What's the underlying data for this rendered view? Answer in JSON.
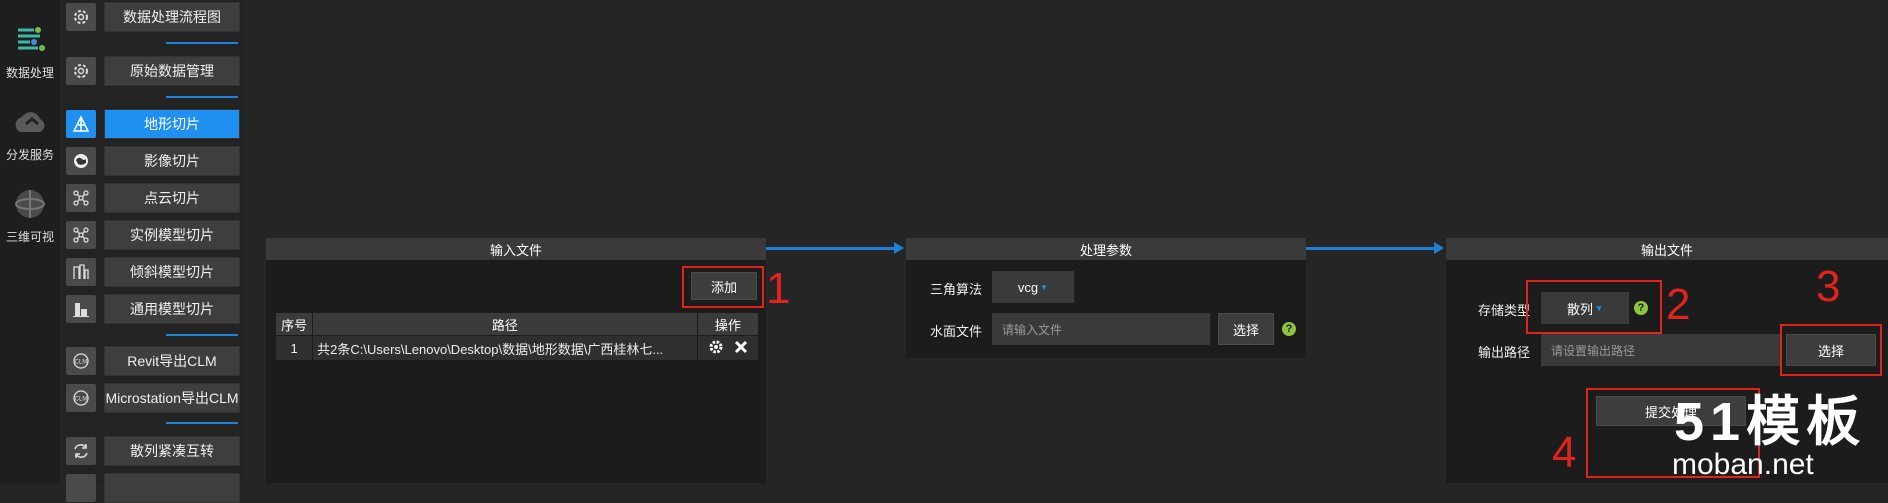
{
  "leftnav": {
    "items": [
      {
        "label": "数据处理",
        "icon": "data-process-icon"
      },
      {
        "label": "分发服务",
        "icon": "cloud-icon"
      },
      {
        "label": "三维可视",
        "icon": "globe-icon"
      }
    ]
  },
  "menu": {
    "items": [
      {
        "label": "数据处理流程图",
        "icon": "gear-icon"
      },
      {
        "label": "原始数据管理",
        "icon": "gear-icon"
      },
      {
        "label": "地形切片",
        "icon": "terrain-icon"
      },
      {
        "label": "影像切片",
        "icon": "image-globe-icon"
      },
      {
        "label": "点云切片",
        "icon": "pointcloud-icon"
      },
      {
        "label": "实例模型切片",
        "icon": "instance-model-icon"
      },
      {
        "label": "倾斜模型切片",
        "icon": "oblique-model-icon"
      },
      {
        "label": "通用模型切片",
        "icon": "general-model-icon"
      },
      {
        "label": "Revit导出CLM",
        "icon": "clm-icon"
      },
      {
        "label": "Microstation导出CLM",
        "icon": "clm-icon"
      },
      {
        "label": "散列紧凑互转",
        "icon": "convert-icon"
      }
    ]
  },
  "input_panel": {
    "title": "输入文件",
    "add_label": "添加",
    "columns": [
      "序号",
      "路径",
      "操作"
    ],
    "rows": [
      {
        "index": "1",
        "path": "共2条C:\\Users\\Lenovo\\Desktop\\数据\\地形数据\\广西桂林七..."
      }
    ]
  },
  "params_panel": {
    "title": "处理参数",
    "algo_label": "三角算法",
    "algo_value": "vcg",
    "water_label": "水面文件",
    "water_placeholder": "请输入文件",
    "select_label": "选择",
    "help": "?"
  },
  "output_panel": {
    "title": "输出文件",
    "storage_label": "存储类型",
    "storage_value": "散列",
    "path_label": "输出路径",
    "path_placeholder": "请设置输出路径",
    "select_label": "选择",
    "submit_label": "提交处理",
    "help": "?"
  },
  "annotations": [
    "1",
    "2",
    "3",
    "4"
  ],
  "watermark": {
    "main": "51模板",
    "sub": "moban.net"
  },
  "colors": {
    "accent": "#1f8ff0",
    "annotation": "#e0231c",
    "help": "#8cc63f"
  }
}
